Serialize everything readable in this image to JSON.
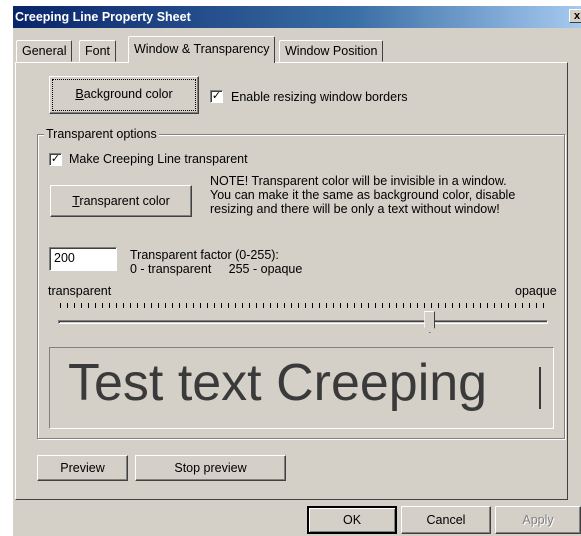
{
  "window": {
    "title": "Creeping Line Property Sheet",
    "close_glyph": "x"
  },
  "tabs": [
    {
      "label": "General"
    },
    {
      "label": "Font"
    },
    {
      "label": "Window & Transparency",
      "active": true
    },
    {
      "label": "Window Position"
    }
  ],
  "appearance": {
    "background_color_button": {
      "mnemonic": "B",
      "rest": "ackground color"
    },
    "enable_resizing": {
      "label": "Enable resizing window borders",
      "checked": true
    }
  },
  "transparent_options": {
    "group_title": "Transparent options",
    "make_transparent": {
      "label": "Make Creeping Line transparent",
      "checked": true
    },
    "transparent_color_button": {
      "mnemonic": "T",
      "rest": "ransparent color"
    },
    "note_lines": [
      "NOTE! Transparent color will be invisible in a window.",
      "You can make it the same as background color, disable",
      "resizing and there will be only a text without window!"
    ],
    "factor": {
      "value": "200",
      "label_line1": "Transparent factor (0-255):",
      "label_line2": "0 - transparent     255 - opaque"
    },
    "slider": {
      "left_label": "transparent",
      "right_label": "opaque",
      "value": 200,
      "min": 0,
      "max": 255
    },
    "preview_text": "Test text Creeping"
  },
  "actions": {
    "preview": "Preview",
    "stop_preview": "Stop preview"
  },
  "footer": {
    "ok": "OK",
    "cancel": "Cancel",
    "apply": "Apply"
  },
  "colors": {
    "dialog_face": "#d4d0c8",
    "titlebar_start": "#0a246a",
    "titlebar_end": "#a6caf0"
  },
  "icons": {
    "checkbox_checked": "check-mark-icon",
    "close": "close-icon"
  }
}
